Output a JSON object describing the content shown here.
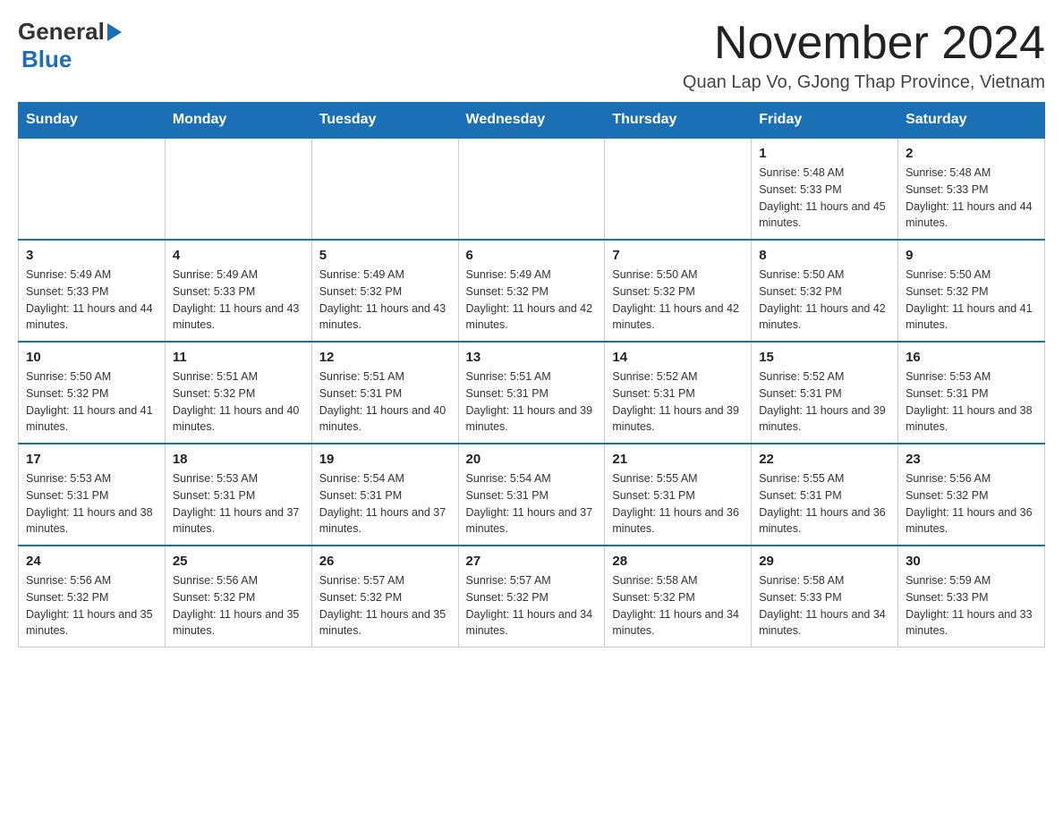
{
  "header": {
    "logo": {
      "general": "General",
      "blue": "Blue"
    },
    "title": "November 2024",
    "subtitle": "Quan Lap Vo, GJong Thap Province, Vietnam"
  },
  "days_of_week": [
    "Sunday",
    "Monday",
    "Tuesday",
    "Wednesday",
    "Thursday",
    "Friday",
    "Saturday"
  ],
  "weeks": [
    [
      {
        "day": "",
        "info": ""
      },
      {
        "day": "",
        "info": ""
      },
      {
        "day": "",
        "info": ""
      },
      {
        "day": "",
        "info": ""
      },
      {
        "day": "",
        "info": ""
      },
      {
        "day": "1",
        "info": "Sunrise: 5:48 AM\nSunset: 5:33 PM\nDaylight: 11 hours and 45 minutes."
      },
      {
        "day": "2",
        "info": "Sunrise: 5:48 AM\nSunset: 5:33 PM\nDaylight: 11 hours and 44 minutes."
      }
    ],
    [
      {
        "day": "3",
        "info": "Sunrise: 5:49 AM\nSunset: 5:33 PM\nDaylight: 11 hours and 44 minutes."
      },
      {
        "day": "4",
        "info": "Sunrise: 5:49 AM\nSunset: 5:33 PM\nDaylight: 11 hours and 43 minutes."
      },
      {
        "day": "5",
        "info": "Sunrise: 5:49 AM\nSunset: 5:32 PM\nDaylight: 11 hours and 43 minutes."
      },
      {
        "day": "6",
        "info": "Sunrise: 5:49 AM\nSunset: 5:32 PM\nDaylight: 11 hours and 42 minutes."
      },
      {
        "day": "7",
        "info": "Sunrise: 5:50 AM\nSunset: 5:32 PM\nDaylight: 11 hours and 42 minutes."
      },
      {
        "day": "8",
        "info": "Sunrise: 5:50 AM\nSunset: 5:32 PM\nDaylight: 11 hours and 42 minutes."
      },
      {
        "day": "9",
        "info": "Sunrise: 5:50 AM\nSunset: 5:32 PM\nDaylight: 11 hours and 41 minutes."
      }
    ],
    [
      {
        "day": "10",
        "info": "Sunrise: 5:50 AM\nSunset: 5:32 PM\nDaylight: 11 hours and 41 minutes."
      },
      {
        "day": "11",
        "info": "Sunrise: 5:51 AM\nSunset: 5:32 PM\nDaylight: 11 hours and 40 minutes."
      },
      {
        "day": "12",
        "info": "Sunrise: 5:51 AM\nSunset: 5:31 PM\nDaylight: 11 hours and 40 minutes."
      },
      {
        "day": "13",
        "info": "Sunrise: 5:51 AM\nSunset: 5:31 PM\nDaylight: 11 hours and 39 minutes."
      },
      {
        "day": "14",
        "info": "Sunrise: 5:52 AM\nSunset: 5:31 PM\nDaylight: 11 hours and 39 minutes."
      },
      {
        "day": "15",
        "info": "Sunrise: 5:52 AM\nSunset: 5:31 PM\nDaylight: 11 hours and 39 minutes."
      },
      {
        "day": "16",
        "info": "Sunrise: 5:53 AM\nSunset: 5:31 PM\nDaylight: 11 hours and 38 minutes."
      }
    ],
    [
      {
        "day": "17",
        "info": "Sunrise: 5:53 AM\nSunset: 5:31 PM\nDaylight: 11 hours and 38 minutes."
      },
      {
        "day": "18",
        "info": "Sunrise: 5:53 AM\nSunset: 5:31 PM\nDaylight: 11 hours and 37 minutes."
      },
      {
        "day": "19",
        "info": "Sunrise: 5:54 AM\nSunset: 5:31 PM\nDaylight: 11 hours and 37 minutes."
      },
      {
        "day": "20",
        "info": "Sunrise: 5:54 AM\nSunset: 5:31 PM\nDaylight: 11 hours and 37 minutes."
      },
      {
        "day": "21",
        "info": "Sunrise: 5:55 AM\nSunset: 5:31 PM\nDaylight: 11 hours and 36 minutes."
      },
      {
        "day": "22",
        "info": "Sunrise: 5:55 AM\nSunset: 5:31 PM\nDaylight: 11 hours and 36 minutes."
      },
      {
        "day": "23",
        "info": "Sunrise: 5:56 AM\nSunset: 5:32 PM\nDaylight: 11 hours and 36 minutes."
      }
    ],
    [
      {
        "day": "24",
        "info": "Sunrise: 5:56 AM\nSunset: 5:32 PM\nDaylight: 11 hours and 35 minutes."
      },
      {
        "day": "25",
        "info": "Sunrise: 5:56 AM\nSunset: 5:32 PM\nDaylight: 11 hours and 35 minutes."
      },
      {
        "day": "26",
        "info": "Sunrise: 5:57 AM\nSunset: 5:32 PM\nDaylight: 11 hours and 35 minutes."
      },
      {
        "day": "27",
        "info": "Sunrise: 5:57 AM\nSunset: 5:32 PM\nDaylight: 11 hours and 34 minutes."
      },
      {
        "day": "28",
        "info": "Sunrise: 5:58 AM\nSunset: 5:32 PM\nDaylight: 11 hours and 34 minutes."
      },
      {
        "day": "29",
        "info": "Sunrise: 5:58 AM\nSunset: 5:33 PM\nDaylight: 11 hours and 34 minutes."
      },
      {
        "day": "30",
        "info": "Sunrise: 5:59 AM\nSunset: 5:33 PM\nDaylight: 11 hours and 33 minutes."
      }
    ]
  ]
}
